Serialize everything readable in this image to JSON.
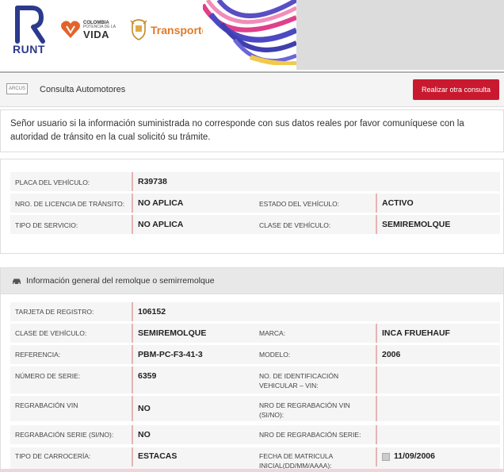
{
  "header": {
    "runt_label": "RUNT",
    "colombia_line1": "COLOMBIA",
    "colombia_line2": "POTENCIA DE LA",
    "colombia_line3": "VIDA",
    "transporte_label": "Transporte"
  },
  "consulta": {
    "icon_text": "ARCUS",
    "title": "Consulta Automotores",
    "button_label": "Realizar otra consulta"
  },
  "notice": "Señor usuario si la información suministrada no corresponde con sus datos reales por favor comuníquese con la autoridad de tránsito en la cual solicitó su trámite.",
  "vehicle": {
    "placa_label": "PLACA DEL VEHÍCULO:",
    "placa_value": "R39738",
    "licencia_label": "NRO. DE LICENCIA DE TRÁNSITO:",
    "licencia_value": "NO APLICA",
    "estado_label": "ESTADO DEL VEHÍCULO:",
    "estado_value": "ACTIVO",
    "servicio_label": "TIPO DE SERVICIO:",
    "servicio_value": "NO APLICA",
    "clase_label": "CLASE DE VEHÍCULO:",
    "clase_value": "SEMIREMOLQUE"
  },
  "remolque": {
    "section_title": "Información general del remolque o semirremolque",
    "tarjeta_label": "TARJETA DE REGISTRO:",
    "tarjeta_value": "106152",
    "clase_label": "CLASE DE VEHÍCULO:",
    "clase_value": "SEMIREMOLQUE",
    "marca_label": "MARCA:",
    "marca_value": "INCA FRUEHAUF",
    "referencia_label": "REFERENCIA:",
    "referencia_value": "PBM-PC-F3-41-3",
    "modelo_label": "MODELO:",
    "modelo_value": "2006",
    "serie_label": "NÚMERO DE SERIE:",
    "serie_value": "6359",
    "vin_label_1": "NO. DE IDENTIFICACIÓN",
    "vin_label_2": "VEHICULAR – VIN:",
    "vin_value": "",
    "regrabacion_vin_label": "REGRABACIÓN VIN",
    "regrabacion_vin_value": "NO",
    "nro_regrabacion_vin_label_1": "NRO DE REGRABACIÓN VIN",
    "nro_regrabacion_vin_label_2": "(SI/NO):",
    "nro_regrabacion_vin_value": "",
    "regrabacion_serie_label": "REGRABACIÓN SERIE (SI/NO):",
    "regrabacion_serie_value": "NO",
    "nro_regrabacion_serie_label": "NRO DE REGRABACIÓN SERIE:",
    "nro_regrabacion_serie_value": "",
    "carroceria_label": "TIPO DE CARROCERÍA:",
    "carroceria_value": "ESTACAS",
    "fecha_label_1": "FECHA DE MATRICULA",
    "fecha_label_2": "INICIAL(DD/MM/AAAA):",
    "fecha_value": "11/09/2006"
  },
  "colors": {
    "brand_red": "#c9192f",
    "runt_blue": "#2b3a8c",
    "transporte_orange": "#e07b2a"
  },
  "icons": [
    "runt-logo-icon",
    "colombia-heart-icon",
    "colombia-shield-icon",
    "brand-swirl-icon",
    "arcus-icon",
    "car-icon",
    "calendar-icon"
  ]
}
